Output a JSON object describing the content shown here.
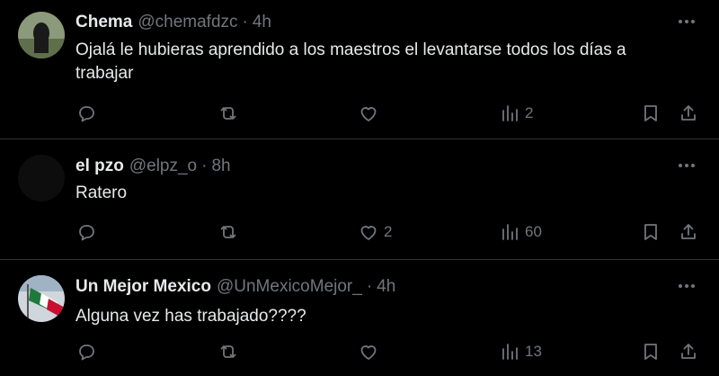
{
  "replies": [
    {
      "name": "Chema",
      "handle": "@chemafdzc",
      "dot": "·",
      "time": "4h",
      "text": "Ojalá le hubieras aprendido a los maestros el levantarse todos los días a trabajar",
      "likes": "",
      "views": "2",
      "avatar": "avatar-dark-figure"
    },
    {
      "name": "el pzo",
      "handle": "@elpz_o",
      "dot": "·",
      "time": "8h",
      "text": "Ratero",
      "likes": "2",
      "views": "60",
      "avatar": "avatar-black"
    },
    {
      "name": "Un Mejor Mexico",
      "handle": "@UnMexicoMejor_",
      "dot": "·",
      "time": "4h",
      "text": "Alguna vez has trabajado????",
      "likes": "",
      "views": "13",
      "avatar": "avatar-mexico-flag"
    }
  ],
  "icons": {
    "reply": "comment-icon",
    "retweet": "retweet-icon",
    "like": "heart-icon",
    "views": "views-chart-icon",
    "bookmark": "bookmark-icon",
    "share": "share-icon",
    "more": "more-options-icon"
  },
  "colors": {
    "background": "#000000",
    "text": "#e7e9ea",
    "secondary": "#71767b",
    "divider": "#2f3336"
  }
}
